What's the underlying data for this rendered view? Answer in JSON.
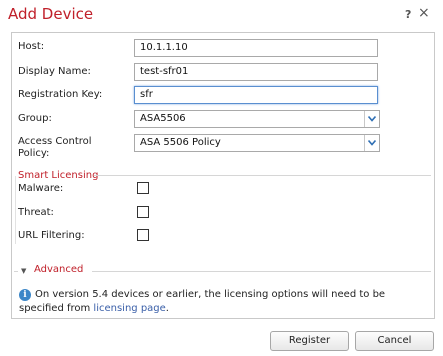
{
  "dialog": {
    "title": "Add Device",
    "help_glyph": "?",
    "close_glyph": "×"
  },
  "form": {
    "host_label": "Host:",
    "host_value": "10.1.1.10",
    "display_name_label": "Display Name:",
    "display_name_value": "test-sfr01",
    "reg_key_label": "Registration Key:",
    "reg_key_value": "sfr",
    "group_label": "Group:",
    "group_value": "ASA5506",
    "acp_label_line1": "Access Control",
    "acp_label_line2": "Policy:",
    "acp_value": "ASA 5506 Policy"
  },
  "licensing": {
    "title": "Smart Licensing",
    "malware_label": "Malware:",
    "malware_checked": false,
    "threat_label": "Threat:",
    "threat_checked": false,
    "url_label": "URL Filtering:",
    "url_checked": false
  },
  "advanced": {
    "label": "Advanced",
    "toggle_glyph": "▼"
  },
  "info": {
    "icon_glyph": "i",
    "text_before": "On version 5.4 devices or earlier, the licensing options will need to be specified from ",
    "link": "licensing page",
    "text_after": "."
  },
  "buttons": {
    "register": "Register",
    "cancel": "Cancel"
  },
  "colors": {
    "accent_red": "#c0202a",
    "info_blue": "#3c87c8",
    "link_blue": "#3a5fa8",
    "focus_border": "#5a8fd0"
  }
}
